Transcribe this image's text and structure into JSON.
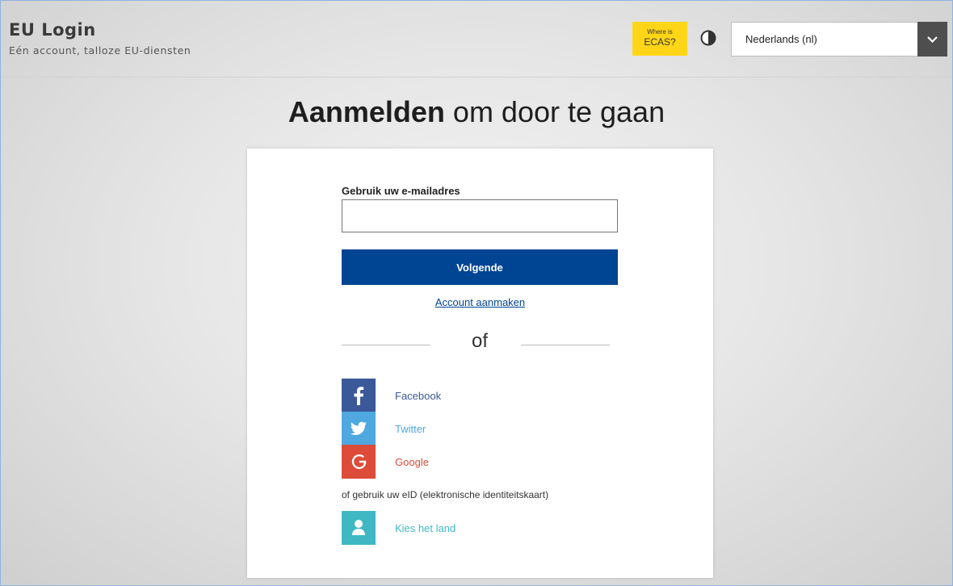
{
  "header": {
    "title": "EU Login",
    "subtitle": "Eén account, talloze EU-diensten",
    "ecas_small": "Where is",
    "ecas_big": "ECAS?",
    "contrast_icon": "contrast-icon",
    "language_value": "Nederlands (nl)"
  },
  "main": {
    "heading_bold": "Aanmelden",
    "heading_rest": " om door te gaan",
    "email_label": "Gebruik uw e-mailadres",
    "email_value": "",
    "next_label": "Volgende",
    "create_account": "Account aanmaken",
    "or_text": "of",
    "social": [
      {
        "label": "Facebook",
        "icon": "facebook-icon",
        "color": "#3b5998",
        "text_color": "#3b5998"
      },
      {
        "label": "Twitter",
        "icon": "twitter-icon",
        "color": "#4fa8e0",
        "text_color": "#4fa8e0"
      },
      {
        "label": "Google",
        "icon": "google-icon",
        "color": "#dd4b39",
        "text_color": "#dd4b39"
      }
    ],
    "eid_text": "of gebruik uw eID (elektronische identiteitskaart)",
    "country": {
      "label": "Kies het land",
      "icon": "user-icon",
      "color": "#3fb8c4",
      "text_color": "#3fb8c4"
    }
  },
  "colors": {
    "primary": "#004494",
    "ecas_yellow": "#ffd617"
  }
}
